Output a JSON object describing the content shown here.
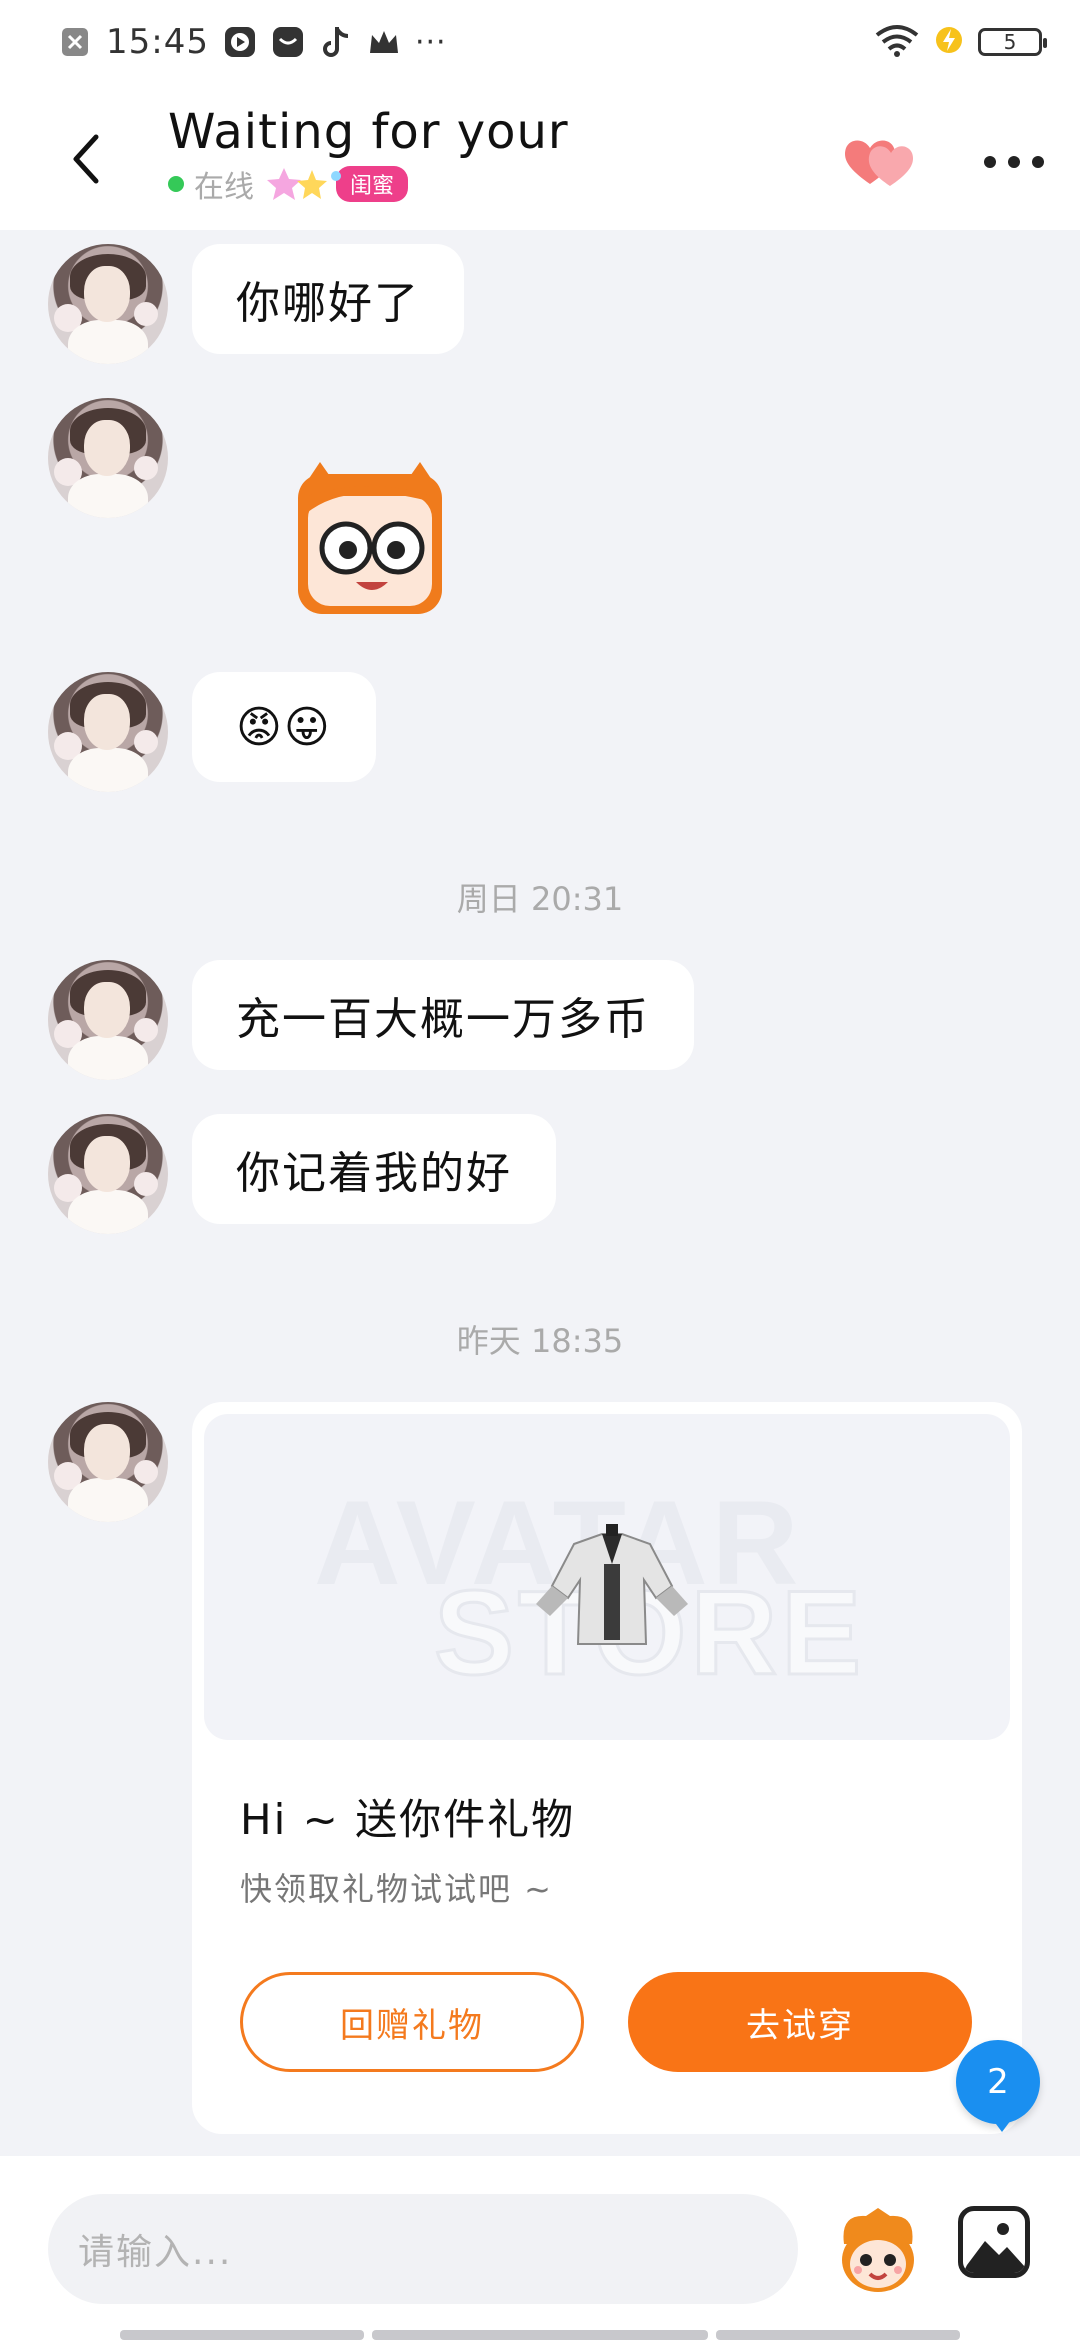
{
  "status_bar": {
    "time": "15:45",
    "battery": "5",
    "icons": [
      "close-box-icon",
      "play-icon",
      "message-icon",
      "tiktok-icon",
      "crown-icon",
      "more-dots-icon",
      "wifi-icon",
      "charging-bolt-icon",
      "battery-icon"
    ],
    "more": "···"
  },
  "header": {
    "title": "Waiting for your",
    "online": "在线",
    "relation_badge": "闺蜜"
  },
  "messages": [
    {
      "text": "你哪好了"
    },
    {
      "text": "😡😛"
    },
    {
      "text": "充一百大概一万多币"
    },
    {
      "text": "你记着我的好"
    }
  ],
  "timestamps": [
    "周日 20:31",
    "昨天 18:35"
  ],
  "gift": {
    "watermark_1": "AVATAR",
    "watermark_2": "STORE",
    "title": "Hi ~ 送你件礼物",
    "subtitle": "快领取礼物试试吧 ~",
    "return_label": "回赠礼物",
    "try_label": "去试穿"
  },
  "fab_label": "2",
  "input": {
    "placeholder": "请输入..."
  },
  "colors": {
    "accent_orange": "#f97416",
    "online_green": "#35c958",
    "badge_pink": "#ee3f8a",
    "fab_blue": "#1a8ff0",
    "background": "#f2f3f7"
  }
}
